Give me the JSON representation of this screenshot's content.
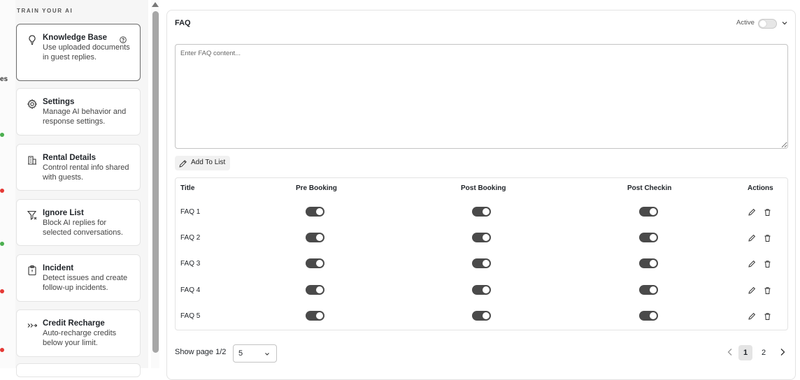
{
  "sidebar": {
    "heading": "TRAIN YOUR AI",
    "items": [
      {
        "title": "Knowledge Base",
        "desc": "Use uploaded documents in guest replies.",
        "icon": "lightbulb-icon",
        "active": true
      },
      {
        "title": "Settings",
        "desc": "Manage AI behavior and response settings.",
        "icon": "gear-icon"
      },
      {
        "title": "Rental Details",
        "desc": "Control rental info shared with guests.",
        "icon": "building-icon"
      },
      {
        "title": "Ignore List",
        "desc": "Block AI replies for selected conversations.",
        "icon": "filter-x-icon"
      },
      {
        "title": "Incident",
        "desc": "Detect issues and create follow-up incidents.",
        "icon": "clipboard-icon"
      },
      {
        "title": "Credit Recharge",
        "desc": "Auto-recharge credits below your limit.",
        "icon": "recharge-icon"
      }
    ]
  },
  "faq": {
    "title": "FAQ",
    "active_label": "Active",
    "active": false,
    "placeholder": "Enter FAQ content...",
    "add_button": "Add To List"
  },
  "table": {
    "columns": [
      "Title",
      "Pre Booking",
      "Post Booking",
      "Post Checkin",
      "Actions"
    ],
    "rows": [
      {
        "title": "FAQ 1",
        "pre_booking": true,
        "post_booking": true,
        "post_checkin": true
      },
      {
        "title": "FAQ 2",
        "pre_booking": true,
        "post_booking": true,
        "post_checkin": true
      },
      {
        "title": "FAQ 3",
        "pre_booking": true,
        "post_booking": true,
        "post_checkin": true
      },
      {
        "title": "FAQ 4",
        "pre_booking": true,
        "post_booking": true,
        "post_checkin": true
      },
      {
        "title": "FAQ 5",
        "pre_booking": true,
        "post_booking": true,
        "post_checkin": true
      }
    ]
  },
  "pagination": {
    "label": "Show page 1/2",
    "page_size": "5",
    "pages": [
      "1",
      "2"
    ],
    "current": "1"
  },
  "colors": {
    "toggle_on": "#4a4a4a",
    "toggle_off": "#e6e6e6",
    "active_card_border": "#6b6b6b"
  }
}
